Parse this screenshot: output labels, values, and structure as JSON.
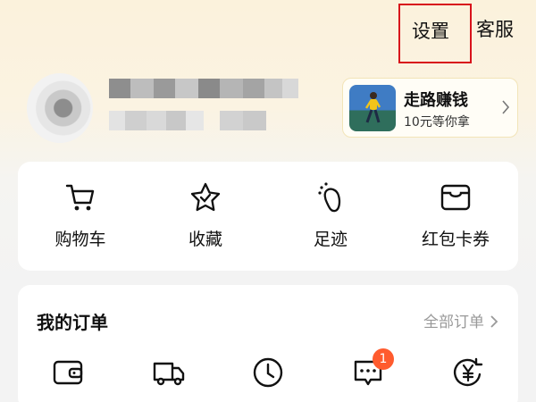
{
  "header": {
    "settings_label": "设置",
    "service_label": "客服"
  },
  "promo": {
    "title": "走路赚钱",
    "subtitle": "10元等你拿"
  },
  "quick_actions": [
    {
      "label": "购物车",
      "icon": "cart-icon"
    },
    {
      "label": "收藏",
      "icon": "star-icon"
    },
    {
      "label": "足迹",
      "icon": "footprint-icon"
    },
    {
      "label": "红包卡券",
      "icon": "coupon-icon"
    }
  ],
  "orders": {
    "title": "我的订单",
    "all_label": "全部订单",
    "icons": [
      "wallet-icon",
      "truck-icon",
      "clock-icon",
      "chat-icon",
      "yen-refund-icon"
    ],
    "chat_badge": "1"
  },
  "colors": {
    "settings_highlight": "#d8121b",
    "badge": "#ff5b2e"
  }
}
